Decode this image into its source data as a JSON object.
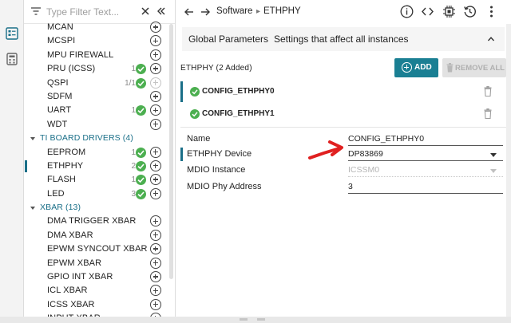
{
  "filter": {
    "placeholder": "Type Filter Text..."
  },
  "sidebar": {
    "items": [
      {
        "label": "MCAN",
        "type": "item",
        "count": "",
        "checked": false,
        "disabled": false
      },
      {
        "label": "MCSPI",
        "type": "item",
        "count": "",
        "checked": false,
        "disabled": false
      },
      {
        "label": "MPU FIREWALL",
        "type": "item",
        "count": "",
        "checked": false,
        "disabled": false
      },
      {
        "label": "PRU (ICSS)",
        "type": "item",
        "count": "1",
        "checked": true,
        "disabled": false
      },
      {
        "label": "QSPI",
        "type": "item",
        "count": "1/1",
        "checked": true,
        "disabled": true
      },
      {
        "label": "SDFM",
        "type": "item",
        "count": "",
        "checked": false,
        "disabled": false
      },
      {
        "label": "UART",
        "type": "item",
        "count": "1",
        "checked": true,
        "disabled": false
      },
      {
        "label": "WDT",
        "type": "item",
        "count": "",
        "checked": false,
        "disabled": false
      },
      {
        "label": "TI BOARD DRIVERS (4)",
        "type": "category"
      },
      {
        "label": "EEPROM",
        "type": "item",
        "count": "1",
        "checked": true,
        "disabled": false
      },
      {
        "label": "ETHPHY",
        "type": "item",
        "count": "2",
        "checked": true,
        "disabled": false,
        "selected": true
      },
      {
        "label": "FLASH",
        "type": "item",
        "count": "1",
        "checked": true,
        "disabled": false
      },
      {
        "label": "LED",
        "type": "item",
        "count": "3",
        "checked": true,
        "disabled": false
      },
      {
        "label": "XBAR (13)",
        "type": "category"
      },
      {
        "label": "DMA TRIGGER XBAR",
        "type": "item",
        "count": "",
        "checked": false,
        "disabled": false
      },
      {
        "label": "DMA XBAR",
        "type": "item",
        "count": "",
        "checked": false,
        "disabled": false
      },
      {
        "label": "EPWM SYNCOUT XBAR",
        "type": "item",
        "count": "",
        "checked": false,
        "disabled": false
      },
      {
        "label": "EPWM XBAR",
        "type": "item",
        "count": "",
        "checked": false,
        "disabled": false
      },
      {
        "label": "GPIO INT XBAR",
        "type": "item",
        "count": "",
        "checked": false,
        "disabled": false
      },
      {
        "label": "ICL XBAR",
        "type": "item",
        "count": "",
        "checked": false,
        "disabled": false
      },
      {
        "label": "ICSS XBAR",
        "type": "item",
        "count": "",
        "checked": false,
        "disabled": false
      },
      {
        "label": "INPUT XBAR",
        "type": "item",
        "count": "",
        "checked": false,
        "disabled": false,
        "cut": true
      }
    ]
  },
  "breadcrumb": {
    "root": "Software",
    "current": "ETHPHY"
  },
  "global": {
    "title": "Global Parameters",
    "desc": "Settings that affect all instances"
  },
  "instances": {
    "title": "ETHPHY (2 Added)",
    "add_label": "ADD",
    "remove_label": "REMOVE ALL",
    "items": [
      {
        "name": "CONFIG_ETHPHY0"
      },
      {
        "name": "CONFIG_ETHPHY1"
      }
    ]
  },
  "properties": [
    {
      "label": "Name",
      "value": "CONFIG_ETHPHY0"
    },
    {
      "label": "ETHPHY Device",
      "value": "DP83869"
    },
    {
      "label": "MDIO Instance",
      "value": "ICSSM0"
    },
    {
      "label": "MDIO Phy Address",
      "value": "3"
    }
  ],
  "colors": {
    "accent": "#1a7f93",
    "check": "#4caf50",
    "annotation": "#e02020"
  }
}
